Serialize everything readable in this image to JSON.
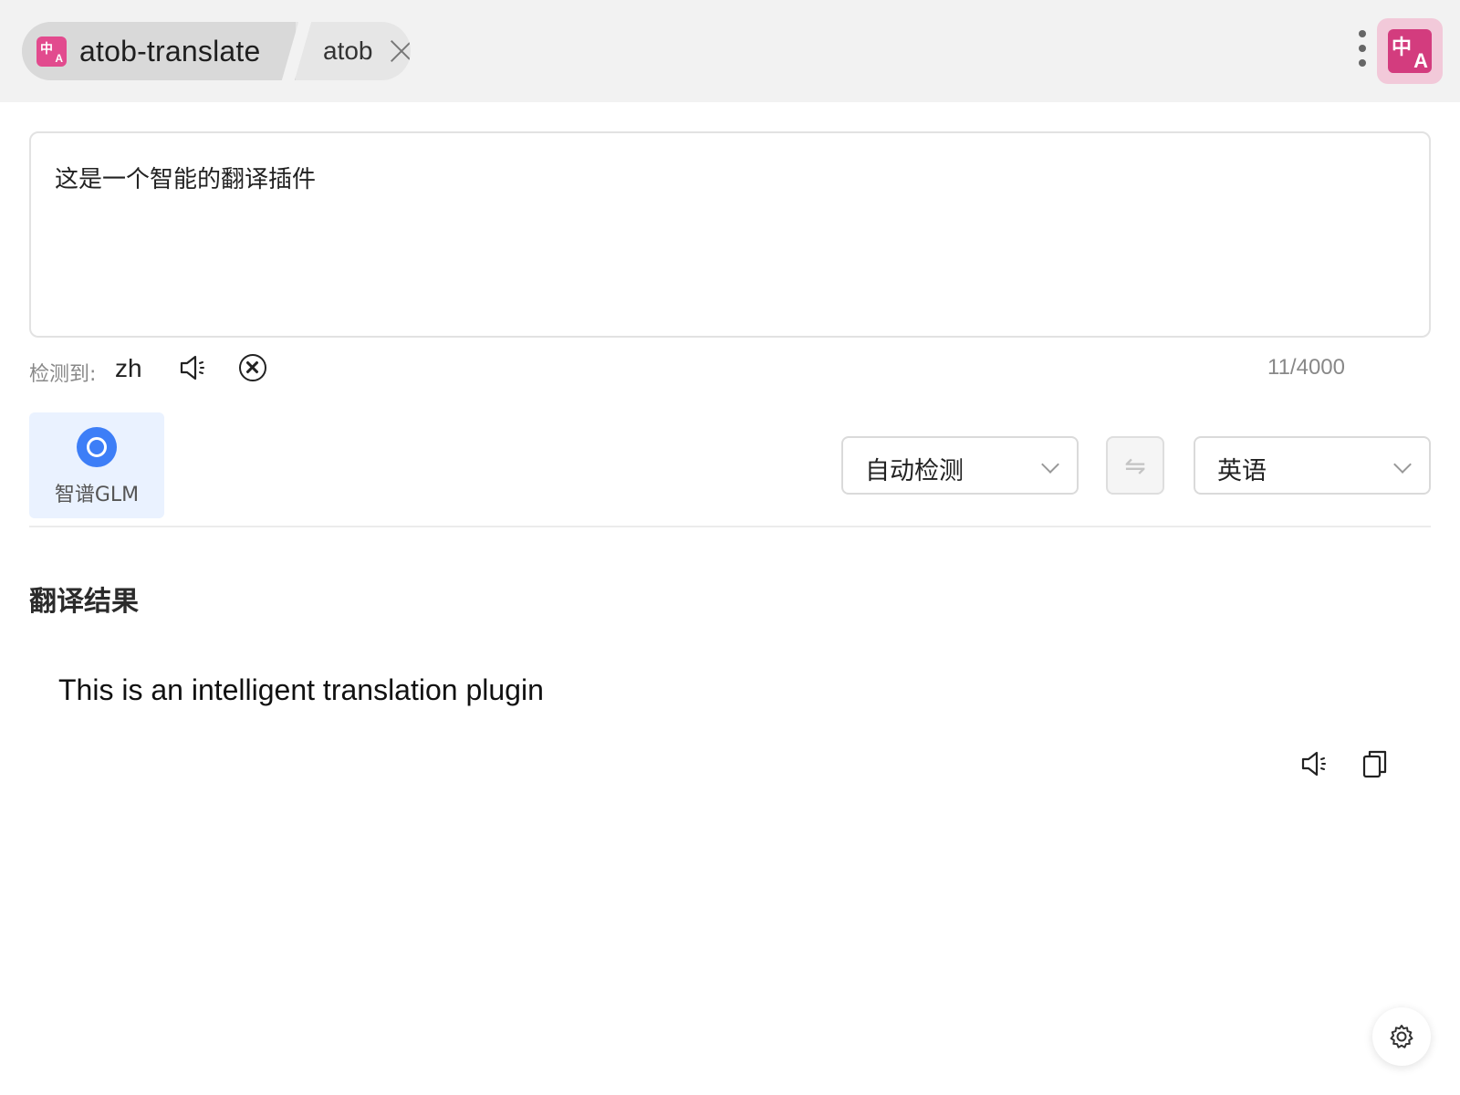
{
  "tabbar": {
    "app_name": "atob-translate",
    "sub_tab": "atob",
    "icon_glyph_top": "中",
    "icon_glyph_bottom": "A"
  },
  "header_icon": {
    "glyph_top": "中",
    "glyph_bottom": "A"
  },
  "input": {
    "text": "这是一个智能的翻译插件"
  },
  "detection": {
    "label": "检测到:",
    "language_code": "zh",
    "char_count": "11/4000"
  },
  "engine": {
    "name": "智谱GLM",
    "selected": true
  },
  "languages": {
    "source": "自动检测",
    "target": "英语",
    "swap_glyph": "⇋"
  },
  "result": {
    "title": "翻译结果",
    "text": "This is an intelligent translation plugin"
  },
  "colors": {
    "brand_pink": "#d33c7e",
    "engine_blue": "#3d7ef7",
    "engine_card_bg": "#eaf2ff"
  },
  "icons": [
    "close-icon",
    "more-vertical-icon",
    "speaker-icon",
    "clear-circle-icon",
    "swap-icon",
    "chevron-down-icon",
    "copy-icon",
    "gear-icon"
  ]
}
